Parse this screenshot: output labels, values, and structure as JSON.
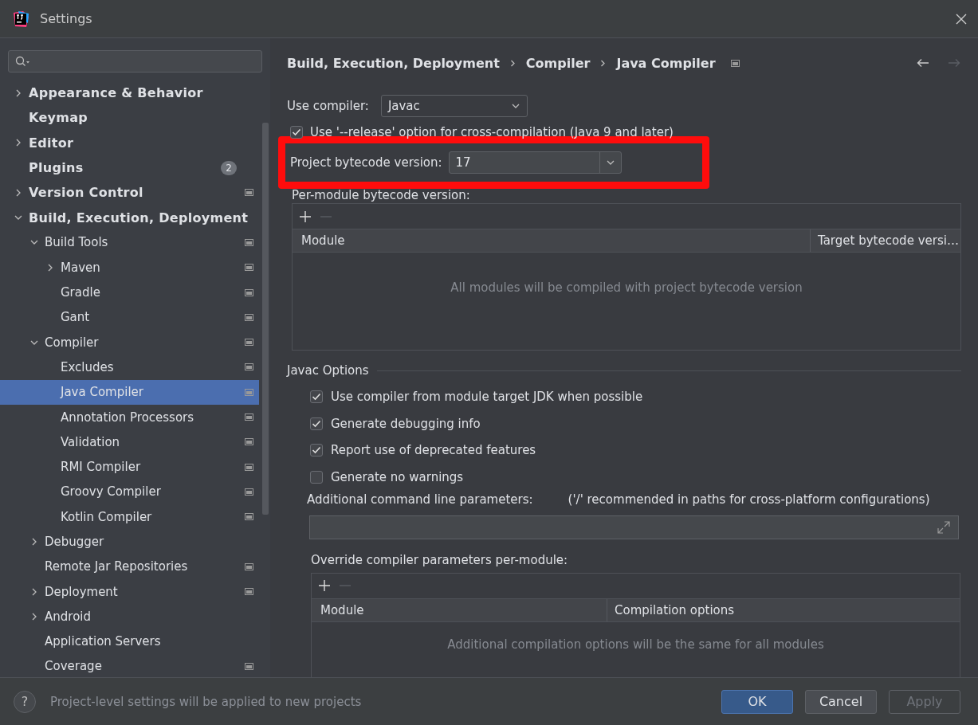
{
  "window": {
    "title": "Settings"
  },
  "sidebar": {
    "items": [
      {
        "label": "Appearance & Behavior",
        "bold": true,
        "expanded": false,
        "expandable": true,
        "project_level": false,
        "selected": false
      },
      {
        "label": "Keymap",
        "bold": true,
        "expandable": false,
        "project_level": false,
        "selected": false
      },
      {
        "label": "Editor",
        "bold": true,
        "expanded": false,
        "expandable": true,
        "project_level": false,
        "selected": false
      },
      {
        "label": "Plugins",
        "bold": true,
        "expandable": false,
        "project_level": false,
        "selected": false,
        "badge": "2"
      },
      {
        "label": "Version Control",
        "bold": true,
        "expanded": false,
        "expandable": true,
        "project_level": true,
        "selected": false
      },
      {
        "label": "Build, Execution, Deployment",
        "bold": true,
        "expanded": true,
        "expandable": true,
        "project_level": false,
        "selected": false,
        "children": [
          {
            "label": "Build Tools",
            "bold": false,
            "expanded": true,
            "expandable": true,
            "project_level": true,
            "selected": false,
            "children": [
              {
                "label": "Maven",
                "bold": false,
                "expanded": false,
                "expandable": true,
                "project_level": true,
                "selected": false
              },
              {
                "label": "Gradle",
                "bold": false,
                "expandable": false,
                "project_level": true,
                "selected": false
              },
              {
                "label": "Gant",
                "bold": false,
                "expandable": false,
                "project_level": true,
                "selected": false
              }
            ]
          },
          {
            "label": "Compiler",
            "bold": false,
            "expanded": true,
            "expandable": true,
            "project_level": true,
            "selected": false,
            "children": [
              {
                "label": "Excludes",
                "bold": false,
                "expandable": false,
                "project_level": true,
                "selected": false
              },
              {
                "label": "Java Compiler",
                "bold": false,
                "expandable": false,
                "project_level": true,
                "selected": true
              },
              {
                "label": "Annotation Processors",
                "bold": false,
                "expandable": false,
                "project_level": true,
                "selected": false
              },
              {
                "label": "Validation",
                "bold": false,
                "expandable": false,
                "project_level": true,
                "selected": false
              },
              {
                "label": "RMI Compiler",
                "bold": false,
                "expandable": false,
                "project_level": true,
                "selected": false
              },
              {
                "label": "Groovy Compiler",
                "bold": false,
                "expandable": false,
                "project_level": true,
                "selected": false
              },
              {
                "label": "Kotlin Compiler",
                "bold": false,
                "expandable": false,
                "project_level": true,
                "selected": false
              }
            ]
          },
          {
            "label": "Debugger",
            "bold": false,
            "expanded": false,
            "expandable": true,
            "project_level": false,
            "selected": false
          },
          {
            "label": "Remote Jar Repositories",
            "bold": false,
            "expandable": false,
            "project_level": true,
            "selected": false
          },
          {
            "label": "Deployment",
            "bold": false,
            "expanded": false,
            "expandable": true,
            "project_level": true,
            "selected": false
          },
          {
            "label": "Android",
            "bold": false,
            "expanded": false,
            "expandable": true,
            "project_level": false,
            "selected": false
          },
          {
            "label": "Application Servers",
            "bold": false,
            "expandable": false,
            "project_level": false,
            "selected": false
          },
          {
            "label": "Coverage",
            "bold": false,
            "expandable": false,
            "project_level": true,
            "selected": false
          }
        ]
      }
    ]
  },
  "breadcrumb": [
    "Build, Execution, Deployment",
    "Compiler",
    "Java Compiler"
  ],
  "nav": {
    "back_enabled": true,
    "forward_enabled": false
  },
  "compiler": {
    "label": "Use compiler:",
    "value": "Javac"
  },
  "release_option": {
    "label": "Use '--release' option for cross-compilation (Java 9 and later)",
    "checked": true
  },
  "bytecode": {
    "label": "Project bytecode version:",
    "value": "17",
    "highlighted": true
  },
  "per_module": {
    "label": "Per-module bytecode version:",
    "columns": [
      "Module",
      "Target bytecode versi…"
    ],
    "empty_text": "All modules will be compiled with project bytecode version"
  },
  "javac_options": {
    "title": "Javac Options",
    "options": [
      {
        "label": "Use compiler from module target JDK when possible",
        "checked": true
      },
      {
        "label": "Generate debugging info",
        "checked": true
      },
      {
        "label": "Report use of deprecated features",
        "checked": true
      },
      {
        "label": "Generate no warnings",
        "checked": false
      }
    ],
    "additional": {
      "label": "Additional command line parameters:",
      "hint": "('/' recommended in paths for cross-platform configurations)"
    },
    "override": {
      "label": "Override compiler parameters per-module:",
      "columns": [
        "Module",
        "Compilation options"
      ],
      "empty_text": "Additional compilation options will be the same for all modules"
    }
  },
  "footer": {
    "help": "?",
    "hint": "Project-level settings will be applied to new projects",
    "buttons": [
      {
        "label": "OK",
        "kind": "primary"
      },
      {
        "label": "Cancel",
        "kind": "normal"
      },
      {
        "label": "Apply",
        "kind": "disabled"
      }
    ]
  }
}
